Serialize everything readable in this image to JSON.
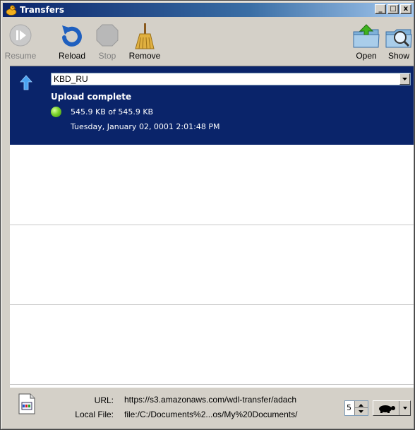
{
  "window": {
    "title": "Transfers",
    "controls": {
      "minimize": "_",
      "maximize": "□",
      "close": "x"
    }
  },
  "toolbar": {
    "resume_label": "Resume",
    "reload_label": "Reload",
    "stop_label": "Stop",
    "remove_label": "Remove",
    "open_label": "Open",
    "show_label": "Show"
  },
  "transfer": {
    "name": "KBD_RU",
    "status": "Upload complete",
    "progress_text": "545.9 KB of 545.9 KB",
    "date": "Tuesday, January 02, 0001 2:01:48 PM"
  },
  "details": {
    "url_label": "URL:",
    "url_value": "https://s3.amazonaws.com/wdl-transfer/adach",
    "local_label": "Local File:",
    "local_value": "file:/C:/Documents%2...os/My%20Documents/",
    "queue_value": "5"
  },
  "colors": {
    "selection": "#0a246a",
    "status_ok": "#7bd22b"
  }
}
